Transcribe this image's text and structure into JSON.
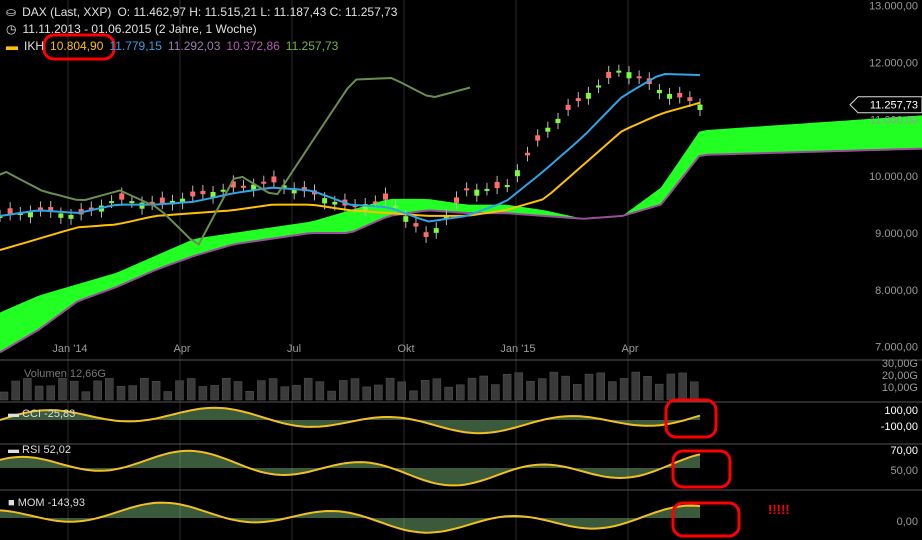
{
  "header": {
    "line1": {
      "icon": "candlestick-icon",
      "symbol": "DAX (Last, XXP)",
      "ohlc": "O: 11.462,97  H: 11.515,21  L: 11.187,43  C: 11.257,73"
    },
    "line2": {
      "icon": "clock-icon",
      "text": "11.11.2013 - 01.06.2015 (2 Jahre, 1 Woche)"
    },
    "line3": {
      "label": "IKH",
      "values": [
        "10.804,90",
        "11.779,15",
        "11.292,03",
        "10.372,86",
        "11.257,73"
      ]
    }
  },
  "colors": {
    "background": "#000000",
    "candle_up": "#7CFC3C",
    "candle_down": "#FF6A6A",
    "cloud": "#22FF22",
    "kijun": "#FFC000",
    "tenkan": "#2FA4E7",
    "chikou": "#6B8E4E",
    "span_b": "#9B4D9B",
    "indicator": "#F0C020",
    "annotation": "#FF0000"
  },
  "price_axis": {
    "ticks": [
      "13.000,00",
      "12.000,00",
      "11.000,00",
      "10.000,00",
      "9.000,00",
      "8.000,00",
      "7.000,00"
    ],
    "last_price": "11.257,73"
  },
  "time_axis": {
    "labels": [
      "Jan '14",
      "Apr",
      "Jul",
      "Okt",
      "Jan '15",
      "Apr"
    ]
  },
  "panels": {
    "volume": {
      "label": "Volumen",
      "value": "12,66G",
      "ticks": [
        "30,00G",
        "20,00G",
        "10,00G"
      ]
    },
    "cci": {
      "label": "CCI",
      "value": "-25,83",
      "ticks": [
        "100,00",
        "-100,00"
      ]
    },
    "rsi": {
      "label": "RSI",
      "value": "52,02",
      "ticks": [
        "70,00",
        "50,00"
      ]
    },
    "mom": {
      "label": "MOM",
      "value": "-143,93",
      "ticks": [
        "0,00"
      ],
      "annotation": "!!!!!"
    }
  },
  "chart_data": {
    "type": "candlestick",
    "x": [
      "2013-11",
      "2013-12",
      "2014-01",
      "2014-02",
      "2014-03",
      "2014-04",
      "2014-05",
      "2014-06",
      "2014-07",
      "2014-08",
      "2014-09",
      "2014-10",
      "2014-11",
      "2014-12",
      "2015-01",
      "2015-02",
      "2015-03",
      "2015-04",
      "2015-05"
    ],
    "close": [
      9300,
      9400,
      9300,
      9600,
      9500,
      9650,
      9800,
      9900,
      9700,
      9450,
      9600,
      8900,
      9750,
      9800,
      10800,
      11400,
      11900,
      11500,
      11260
    ],
    "tenkan": [
      9300,
      9400,
      9350,
      9500,
      9500,
      9550,
      9700,
      9800,
      9750,
      9500,
      9450,
      9200,
      9300,
      9550,
      10100,
      10700,
      11400,
      11800,
      11779
    ],
    "kijun": [
      8700,
      8900,
      9100,
      9150,
      9300,
      9350,
      9400,
      9500,
      9500,
      9400,
      9350,
      9300,
      9300,
      9400,
      9600,
      10200,
      10800,
      11100,
      11292
    ],
    "span_a": [
      7600,
      7900,
      8100,
      8300,
      8600,
      8900,
      9000,
      9100,
      9200,
      9400,
      9600,
      9600,
      9500,
      9500,
      9400,
      9250,
      9300,
      9800,
      10804
    ],
    "span_b": [
      6900,
      7300,
      7800,
      8050,
      8350,
      8600,
      8800,
      8900,
      9000,
      9000,
      9300,
      9400,
      9350,
      9350,
      9300,
      9250,
      9300,
      9500,
      10373
    ],
    "ylim": [
      6800,
      13100
    ]
  }
}
